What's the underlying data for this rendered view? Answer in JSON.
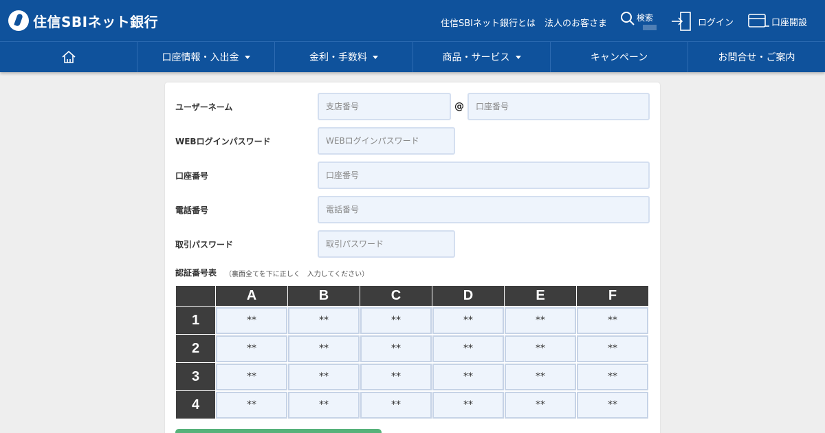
{
  "header": {
    "logo_text": "住信SBIネット銀行",
    "links": {
      "about": "住信SBIネット銀行とは",
      "corporate": "法人のお客さま"
    },
    "search_label": "検索",
    "login_label": "ログイン",
    "open_account_label": "口座開設"
  },
  "nav": {
    "items": [
      {
        "label": "",
        "icon": "home-icon"
      },
      {
        "label": "口座情報・入出金",
        "dropdown": true
      },
      {
        "label": "金利・手数料",
        "dropdown": true
      },
      {
        "label": "商品・サービス",
        "dropdown": true
      },
      {
        "label": "キャンペーン",
        "dropdown": false
      },
      {
        "label": "お問合せ・ご案内",
        "dropdown": false
      }
    ]
  },
  "form": {
    "username": {
      "label": "ユーザーネーム",
      "branch_placeholder": "支店番号",
      "at": "@",
      "account_placeholder": "口座番号"
    },
    "web_password": {
      "label": "WEBログインパスワード",
      "placeholder": "WEBログインパスワード"
    },
    "account_number": {
      "label": "口座番号",
      "placeholder": "口座番号"
    },
    "phone": {
      "label": "電話番号",
      "placeholder": "電話番号"
    },
    "trade_password": {
      "label": "取引パスワード",
      "placeholder": "取引パスワード"
    },
    "auth_table": {
      "label": "認証番号表",
      "hint": "（裏面全てを下に正しく　入力してください）",
      "columns": [
        "A",
        "B",
        "C",
        "D",
        "E",
        "F"
      ],
      "rows": [
        "1",
        "2",
        "3",
        "4"
      ],
      "cell_placeholder": "**"
    }
  },
  "colors": {
    "brand": "#0f529c",
    "input_bg": "#eef4fc",
    "table_header": "#3d3d3d",
    "submit": "#56b27a"
  }
}
